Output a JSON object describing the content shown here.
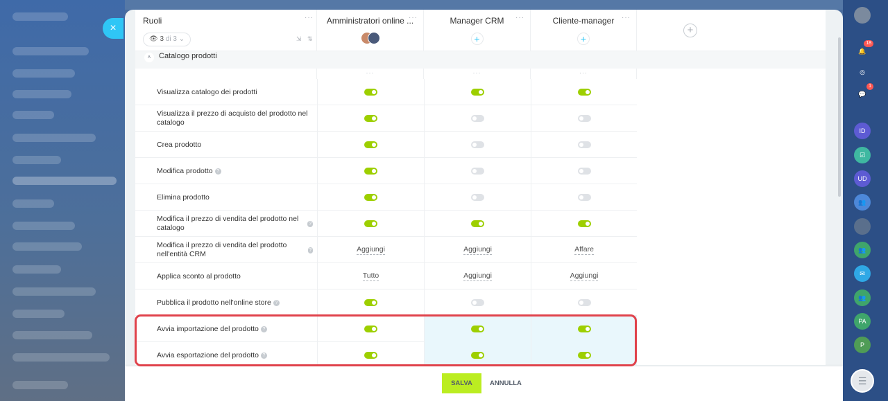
{
  "close_label": "×",
  "header": {
    "roles_title": "Ruoli",
    "menu_dots": "···",
    "filter": {
      "count": "3",
      "of_text": "di 3",
      "caret": "⌄"
    },
    "sort_icon": "⇲ ⇅",
    "columns": [
      {
        "title": "Amministratori online ...",
        "has_avatars": true
      },
      {
        "title": "Manager CRM",
        "add": "+"
      },
      {
        "title": "Cliente-manager",
        "add": "+"
      }
    ],
    "add_role": "+"
  },
  "section": {
    "label": "Catalogo prodotti",
    "chevron": "˄"
  },
  "dots": "···",
  "help_mark": "?",
  "rows": [
    {
      "label": "Visualizza catalogo dei prodotti",
      "help": false,
      "values": [
        "on",
        "on",
        "on"
      ]
    },
    {
      "label": "Visualizza il prezzo di acquisto del prodotto nel catalogo",
      "help": false,
      "values": [
        "on",
        "off",
        "off"
      ]
    },
    {
      "label": "Crea prodotto",
      "help": false,
      "values": [
        "on",
        "off",
        "off"
      ]
    },
    {
      "label": "Modifica prodotto",
      "help": true,
      "values": [
        "on",
        "off",
        "off"
      ]
    },
    {
      "label": "Elimina prodotto",
      "help": false,
      "values": [
        "on",
        "off",
        "off"
      ]
    },
    {
      "label": "Modifica il prezzo di vendita del prodotto nel catalogo",
      "help": true,
      "values": [
        "on",
        "on",
        "on"
      ]
    },
    {
      "label": "Modifica il prezzo di vendita del prodotto nell'entità CRM",
      "help": true,
      "values": [
        "Aggiungi",
        "Aggiungi",
        "Affare"
      ]
    },
    {
      "label": "Applica sconto al prodotto",
      "help": false,
      "values": [
        "Tutto",
        "Aggiungi",
        "Aggiungi"
      ]
    },
    {
      "label": "Pubblica il prodotto nell'online store",
      "help": true,
      "values": [
        "on",
        "off",
        "off"
      ]
    },
    {
      "label": "Avvia importazione del prodotto",
      "help": true,
      "values": [
        "on",
        "on",
        "on"
      ],
      "highlight_cols": [
        1,
        2
      ]
    },
    {
      "label": "Avvia esportazione del prodotto",
      "help": true,
      "values": [
        "on",
        "on",
        "on"
      ],
      "highlight_cols": [
        1,
        2
      ]
    }
  ],
  "footer": {
    "save": "SALVA",
    "cancel": "ANNULLA"
  },
  "right_sidebar": {
    "notifications_badge": "18",
    "chat_badge": "1",
    "items": [
      {
        "icon": "bell-icon",
        "color": "#2c4f86"
      },
      {
        "icon": "target-icon",
        "color": "#2c4f86"
      },
      {
        "icon": "chat-icon",
        "color": "#2c4f86"
      },
      {
        "icon": "user-id-icon",
        "text": "ID",
        "color": "#5d5bd3"
      },
      {
        "icon": "task-icon",
        "color": "#3fb8a1"
      },
      {
        "icon": "user-ud-icon",
        "text": "UD",
        "color": "#5d5bd3"
      },
      {
        "icon": "group-icon",
        "color": "#4d88d9"
      },
      {
        "icon": "avatar-icon",
        "color": "#5a6f8c"
      },
      {
        "icon": "group-icon",
        "color": "#3fa56b"
      },
      {
        "icon": "message-icon",
        "color": "#2fa8e6"
      },
      {
        "icon": "group-icon",
        "color": "#3fa56b"
      },
      {
        "icon": "user-pa-icon",
        "text": "PA",
        "color": "#3fa56b"
      },
      {
        "icon": "user-p-icon",
        "text": "P",
        "color": "#4f9c56"
      }
    ]
  },
  "colors": {
    "toggle_on": "#9dcf00",
    "toggle_off": "#dfe2e6",
    "accent": "#2fc6f6",
    "save": "#bbed21",
    "highlight_border": "#e0424b"
  }
}
